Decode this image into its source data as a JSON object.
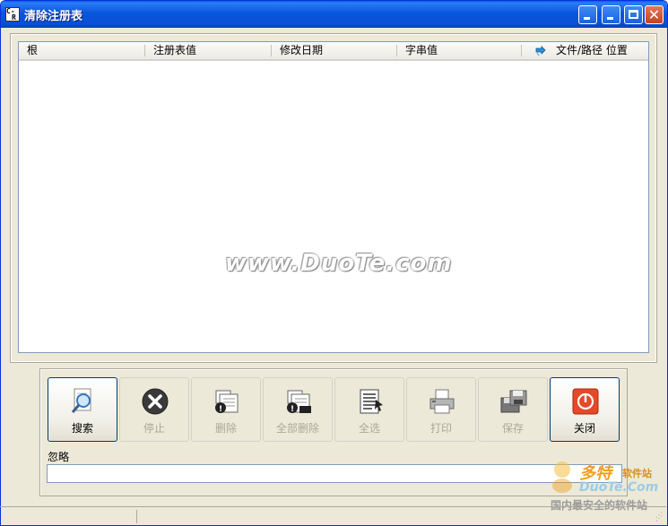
{
  "window": {
    "title": "清除注册表",
    "icon_text_top": "C-",
    "icon_text_bottom": "R",
    "titlebar_color": "#0a53d6",
    "close_color": "#d8552b"
  },
  "listview": {
    "columns": [
      "根",
      "注册表值",
      "修改日期",
      "字串值",
      "文件/路径 位置"
    ],
    "last_column_icon": "sort-arrow-icon",
    "rows": []
  },
  "watermark": "www.DuoTe.com",
  "actions": [
    {
      "label": "搜索",
      "icon": "magnifier-document-icon",
      "enabled": true
    },
    {
      "label": "停止",
      "icon": "stop-x-icon",
      "enabled": false
    },
    {
      "label": "删除",
      "icon": "delete-document-icon",
      "enabled": false
    },
    {
      "label": "全部删除",
      "icon": "delete-all-icon",
      "enabled": false
    },
    {
      "label": "全选",
      "icon": "select-all-icon",
      "enabled": false
    },
    {
      "label": "打印",
      "icon": "printer-icon",
      "enabled": false
    },
    {
      "label": "保存",
      "icon": "save-floppy-icon",
      "enabled": false
    },
    {
      "label": "关闭",
      "icon": "power-close-icon",
      "enabled": true
    }
  ],
  "ignore": {
    "label": "忽略",
    "value": ""
  },
  "logo": {
    "big": "多特",
    "small": "软件站",
    "brand": "DuoTe.Com",
    "tagline": "国内最安全的软件站"
  }
}
